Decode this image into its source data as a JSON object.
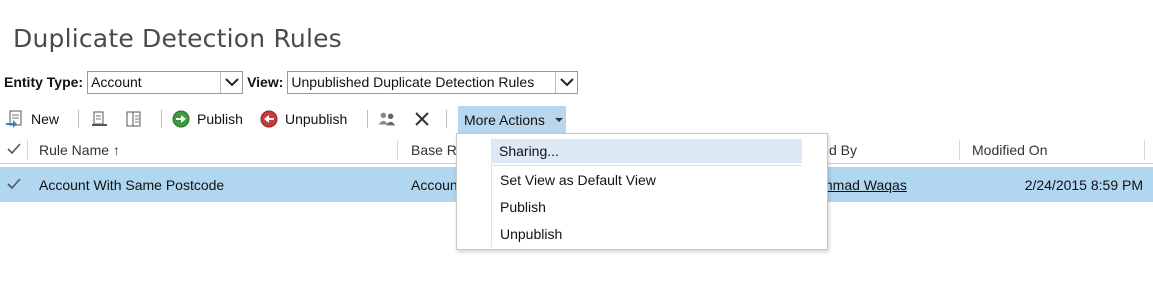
{
  "page": {
    "title": "Duplicate Detection Rules"
  },
  "filters": {
    "entity_label": "Entity Type:",
    "entity_value": "Account",
    "view_label": "View:",
    "view_value": "Unpublished Duplicate Detection Rules"
  },
  "toolbar": {
    "new_label": "New",
    "publish_label": "Publish",
    "unpublish_label": "Unpublish",
    "more_actions_label": "More Actions"
  },
  "grid": {
    "columns": [
      "Rule Name ↑",
      "Base Re",
      "d By",
      "Modified On"
    ],
    "rows": [
      {
        "rule_name": "Account With Same Postcode",
        "base": "Accoun",
        "by": "mmad Waqas",
        "modified": "2/24/2015 8:59 PM"
      }
    ]
  },
  "menu": {
    "items": [
      "Sharing...",
      "Set View as Default View",
      "Publish",
      "Unpublish"
    ]
  },
  "colors": {
    "selection": "#b1d6f0",
    "menu_highlight": "#dde9f5",
    "more_actions_bg": "#b8d6ee"
  }
}
